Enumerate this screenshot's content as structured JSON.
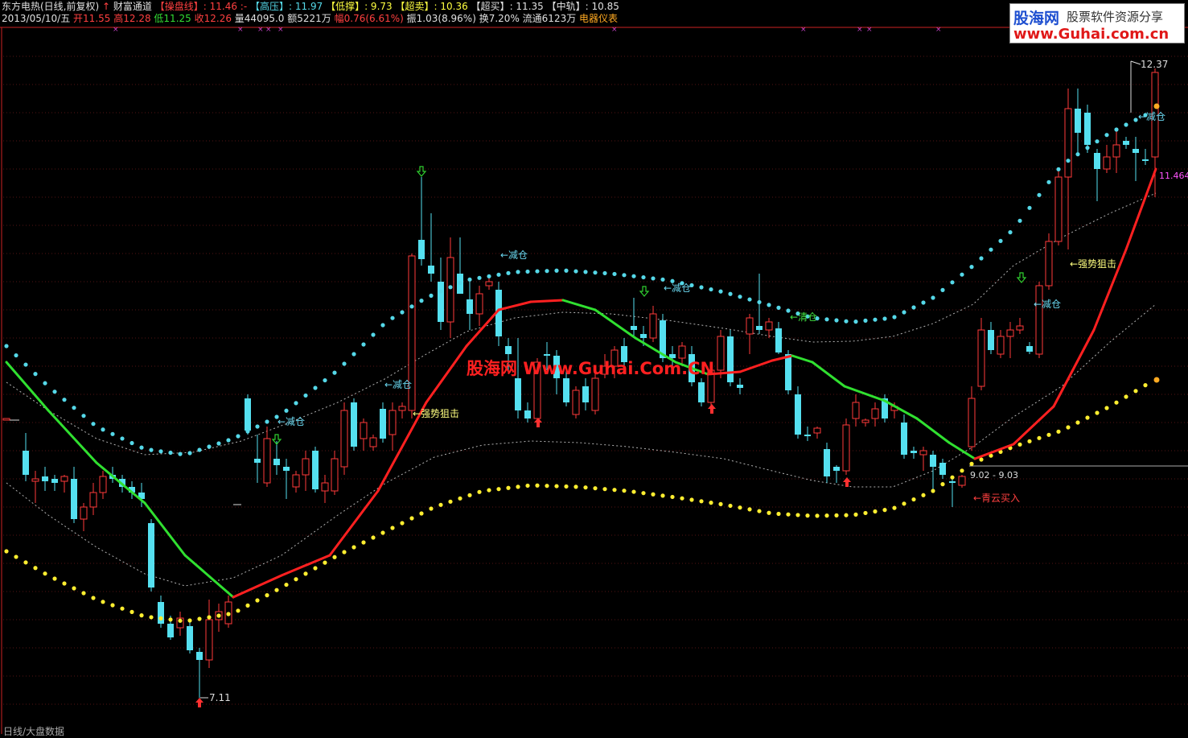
{
  "header": {
    "stock": "东方电热(日线,前复权)",
    "indicator": "财富通道",
    "ops_label": "【操盘线】",
    "ops_value": ": 11.46 :-",
    "high_label": "【高压】",
    "high_value": ": 11.97",
    "low_label": "【低撑】",
    "low_value": ": 9.73",
    "ob_label": "【超卖】",
    "ob_value": ": 10.36",
    "os_label": "【超买】",
    "os_value": ": 11.35",
    "mid_label": "【中轨】",
    "mid_value": ": 10.85"
  },
  "quote": {
    "date": "2013/05/10/五",
    "open": "开11.55",
    "high": "高12.28",
    "low": "低11.25",
    "close": "收12.26",
    "volume": "量44095.0",
    "amount": "额5221万",
    "change": "幅0.76(6.61%)",
    "amplitude": "振1.03(8.96%)",
    "turnover": "换7.20%",
    "float": "流通6123万",
    "gauge": "电器仪表"
  },
  "watermark": {
    "logo_main": "股海网",
    "logo_tagline": "股票软件资源分享",
    "logo_url": "www.Guhai.com.cn",
    "center": "股海网 Www.Guhai.Com.CN"
  },
  "price_labels": {
    "high_mark": "12.37",
    "low_mark": "7.11",
    "current": "11.464",
    "range": "9.02 - 9.03"
  },
  "annotations": [
    {
      "text": "←减仓"
    },
    {
      "text": "←减仓"
    },
    {
      "text": "←减仓"
    },
    {
      "text": "←减仓"
    },
    {
      "text": "←减仓"
    },
    {
      "text": "←强势狙击"
    },
    {
      "text": "←强势狙击"
    },
    {
      "text": "←清仓"
    },
    {
      "text": "←青云买入"
    },
    {
      "text": "←减仓"
    }
  ],
  "bottom_tab": "日线/大盘数据",
  "colors": {
    "up": "#ff3a3a",
    "down": "#55e0f0",
    "ops_up": "#ff2020",
    "ops_down": "#30e030",
    "upper_dots": "#55d8e8",
    "lower_dots": "#ffee30"
  }
}
